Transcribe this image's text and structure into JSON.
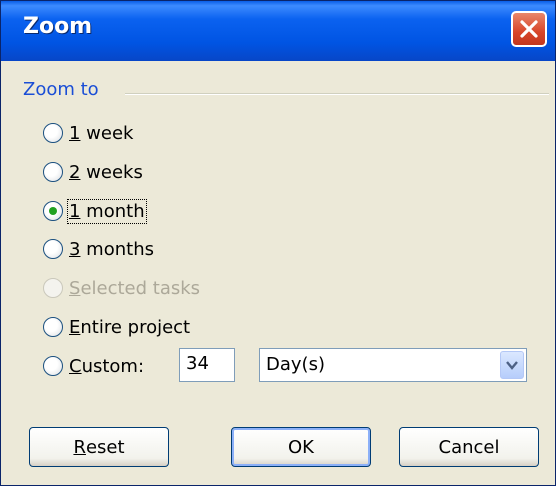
{
  "window": {
    "title": "Zoom",
    "close_icon": "close-icon"
  },
  "group": {
    "label": "Zoom to"
  },
  "options": [
    {
      "id": "1-week",
      "first": "1",
      "rest": " week",
      "checked": false,
      "disabled": false
    },
    {
      "id": "2-weeks",
      "first": "2",
      "rest": " weeks",
      "checked": false,
      "disabled": false
    },
    {
      "id": "1-month",
      "first": "1",
      "rest": " month",
      "checked": true,
      "disabled": false
    },
    {
      "id": "3-months",
      "first": "3",
      "rest": " months",
      "checked": false,
      "disabled": false
    },
    {
      "id": "selected-tasks",
      "first": "S",
      "rest": "elected tasks",
      "checked": false,
      "disabled": true
    },
    {
      "id": "entire-project",
      "first": "E",
      "rest": "ntire project",
      "checked": false,
      "disabled": false
    },
    {
      "id": "custom",
      "first": "C",
      "rest": "ustom:",
      "checked": false,
      "disabled": false
    }
  ],
  "custom": {
    "value": "34",
    "unit": "Day(s)"
  },
  "buttons": {
    "reset_first": "R",
    "reset_rest": "eset",
    "ok": "OK",
    "cancel": "Cancel"
  },
  "colors": {
    "title_bar": "#0054e3",
    "group_label": "#1a4ed6",
    "radio_dot": "#21a121",
    "background": "#ece9d8"
  }
}
